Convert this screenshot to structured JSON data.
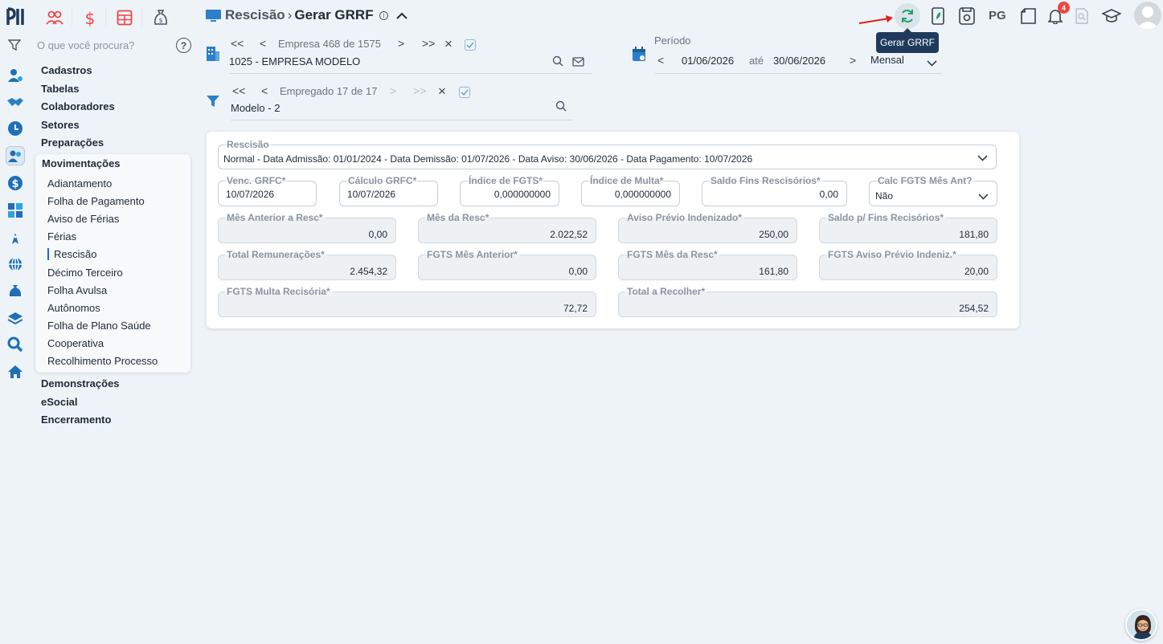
{
  "header": {
    "breadcrumb_parent": "Rescisão",
    "breadcrumb_sep": "›",
    "title": "Gerar GRRF",
    "info_glyph": "i"
  },
  "search": {
    "placeholder": "O que você procura?",
    "help_glyph": "?"
  },
  "menu": {
    "top_items": [
      "Cadastros",
      "Tabelas",
      "Colaboradores",
      "Setores",
      "Preparações"
    ],
    "open_section": "Movimentações",
    "sub_items": [
      "Adiantamento",
      "Folha de Pagamento",
      "Aviso de Férias",
      "Férias",
      "Rescisão",
      "Décimo Terceiro",
      "Folha Avulsa",
      "Autônomos",
      "Folha de Plano Saúde",
      "Cooperativa",
      "Recolhimento Processo"
    ],
    "active_sub": "Rescisão",
    "bottom_items": [
      "Demonstrações",
      "eSocial",
      "Encerramento"
    ]
  },
  "toolbar": {
    "tooltip": "Gerar GRRF",
    "pg_label": "PG",
    "notifications_count": "4"
  },
  "empresa": {
    "nav_first": "<<",
    "nav_prev": "<",
    "nav_next": ">",
    "nav_last": ">>",
    "close": "×",
    "counter": "Empresa 468 de 1575",
    "value": "1025 - EMPRESA MODELO"
  },
  "empregado": {
    "nav_first": "<<",
    "nav_prev": "<",
    "nav_next": ">",
    "nav_last": ">>",
    "close": "×",
    "counter": "Empregado 17 de 17",
    "value": "Modelo - 2"
  },
  "periodo": {
    "label": "Período",
    "nav_prev": "<",
    "nav_next": ">",
    "start": "01/06/2026",
    "until": "até",
    "end": "30/06/2026",
    "type": "Mensal"
  },
  "form": {
    "rescisao": {
      "label": "Rescisão",
      "value": "Normal - Data Admissão: 01/01/2024 - Data Demissão: 01/07/2026 - Data Aviso: 30/06/2026 - Data Pagamento: 10/07/2026"
    },
    "venc_grfc": {
      "label": "Venc. GRFC*",
      "value": "10/07/2026"
    },
    "calculo_grfc": {
      "label": "Cálculo GRFC*",
      "value": "10/07/2026"
    },
    "indice_fgts": {
      "label": "Índice de FGTS*",
      "value": "0,000000000"
    },
    "indice_multa": {
      "label": "Índice de Multa*",
      "value": "0,000000000"
    },
    "saldo_fins": {
      "label": "Saldo Fins Rescisórios*",
      "value": "0,00"
    },
    "calc_fgts_mes_ant": {
      "label": "Calc FGTS Mês Ant?",
      "value": "Não"
    },
    "mes_anterior": {
      "label": "Mês Anterior a Resc*",
      "value": "0,00"
    },
    "mes_resc": {
      "label": "Mês da Resc*",
      "value": "2.022,52"
    },
    "aviso_previo": {
      "label": "Aviso Prévio Indenizado*",
      "value": "250,00"
    },
    "saldo_fins_recisorios": {
      "label": "Saldo p/ Fins Recisórios*",
      "value": "181,80"
    },
    "total_remuneracoes": {
      "label": "Total Remunerações*",
      "value": "2.454,32"
    },
    "fgts_mes_anterior": {
      "label": "FGTS Mês Anterior*",
      "value": "0,00"
    },
    "fgts_mes_resc": {
      "label": "FGTS Mês da Resc*",
      "value": "161,80"
    },
    "fgts_aviso": {
      "label": "FGTS Aviso Prévio Indeniz.*",
      "value": "20,00"
    },
    "fgts_multa": {
      "label": "FGTS Multa Recisória*",
      "value": "72,72"
    },
    "total_recolher": {
      "label": "Total a Recolher*",
      "value": "254,52"
    }
  },
  "colors": {
    "accent": "#2563eb",
    "refresh": "#22a06b",
    "tooltip_bg": "#1f3a5c",
    "badge": "#ef4444",
    "module_red": "#ef4444"
  }
}
